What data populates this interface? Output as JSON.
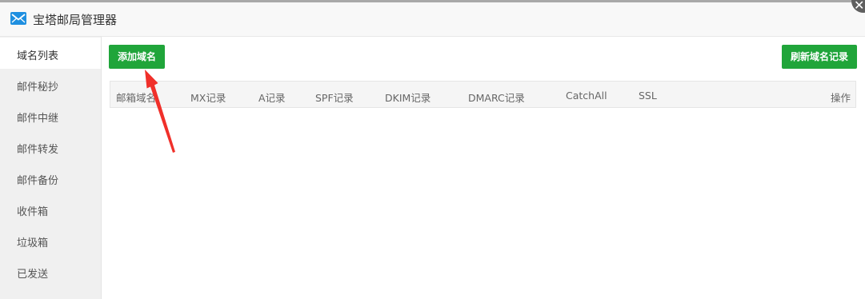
{
  "window": {
    "title": "宝塔邮局管理器",
    "icon": "mail-icon",
    "close_icon": "close-icon"
  },
  "sidebar": {
    "items": [
      {
        "label": "域名列表",
        "active": true
      },
      {
        "label": "邮件秘抄",
        "active": false
      },
      {
        "label": "邮件中继",
        "active": false
      },
      {
        "label": "邮件转发",
        "active": false
      },
      {
        "label": "邮件备份",
        "active": false
      },
      {
        "label": "收件箱",
        "active": false
      },
      {
        "label": "垃圾箱",
        "active": false
      },
      {
        "label": "已发送",
        "active": false
      }
    ]
  },
  "toolbar": {
    "add_domain_label": "添加域名",
    "refresh_label": "刷新域名记录"
  },
  "table": {
    "columns": [
      "邮箱域名",
      "MX记录",
      "A记录",
      "SPF记录",
      "DKIM记录",
      "DMARC记录",
      "CatchAll",
      "SSL",
      "操作"
    ],
    "rows": []
  },
  "colors": {
    "primary": "#20a53a",
    "annotation_arrow": "#f0302a",
    "icon_blue": "#1f8fe0"
  }
}
